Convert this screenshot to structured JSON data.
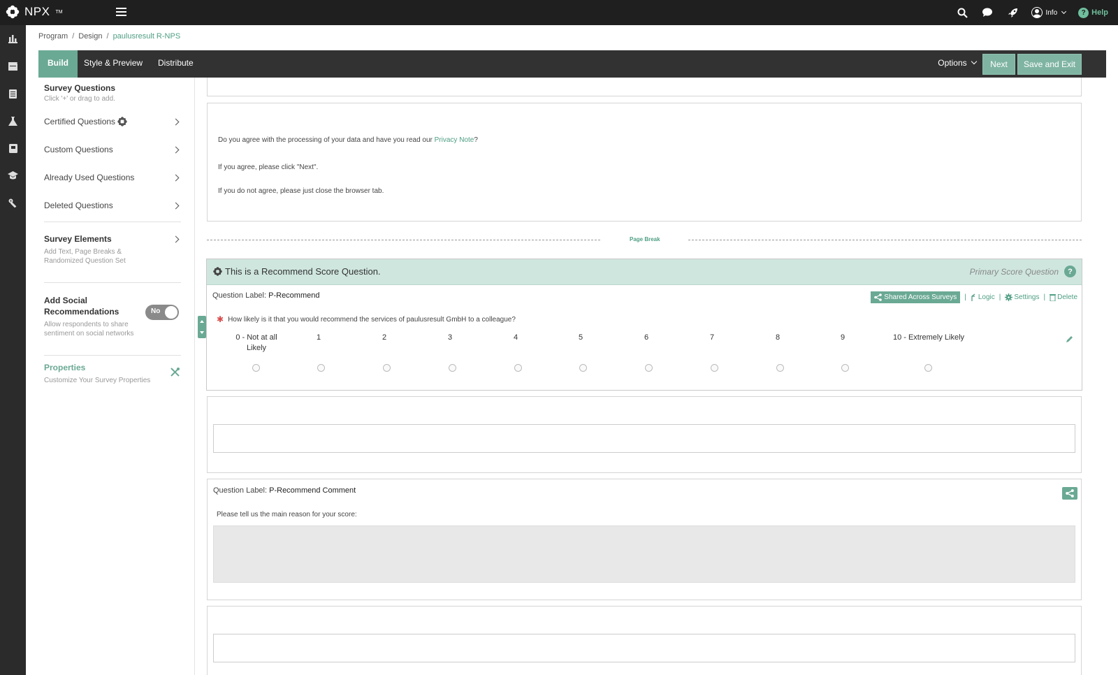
{
  "app": {
    "name": "NPX",
    "tm": "TM"
  },
  "topbar": {
    "icons": [
      "search-icon",
      "chat-icon",
      "rocket-icon"
    ],
    "user_label": "Info",
    "help_label": "Help"
  },
  "rail": [
    "chart-icon",
    "film-icon",
    "book-icon",
    "flask-icon",
    "notebook-icon",
    "graduation-icon",
    "wrench-icon"
  ],
  "breadcrumb": {
    "items": [
      "Program",
      "Design"
    ],
    "current": "paulusresult R-NPS",
    "separator": "/"
  },
  "tabs": {
    "build": "Build",
    "style": "Style & Preview",
    "distribute": "Distribute"
  },
  "actions": {
    "options": "Options",
    "next": "Next",
    "save_exit": "Save and Exit"
  },
  "panel": {
    "survey_questions": {
      "title": "Survey Questions",
      "sub": "Click '+' or drag to add."
    },
    "rows": [
      "Certified Questions",
      "Custom Questions",
      "Already Used Questions",
      "Deleted Questions"
    ],
    "survey_elements": {
      "title": "Survey Elements",
      "sub1": "Add Text, Page Breaks &",
      "sub2": "Randomized Question Set"
    },
    "social": {
      "title1": "Add Social",
      "title2": "Recommendations",
      "toggle": "No",
      "sub1": "Allow respondents to share",
      "sub2": "sentiment on social networks"
    },
    "properties": {
      "title": "Properties",
      "sub": "Customize Your Survey Properties"
    }
  },
  "consent": {
    "line1_pre": "Do you agree with the processing of your data and have you read our ",
    "line1_link": "Privacy Note",
    "line1_post": "?",
    "line2": "If you agree, please click \"Next\".",
    "line3": "If you do not agree, please just close the browser tab."
  },
  "page_break": "Page Break",
  "nps": {
    "header": "This is a Recommend Score Question.",
    "header_right": "Primary Score Question",
    "label_prefix": "Question Label:",
    "label": "P-Recommend",
    "shared": "Shared Across Surveys",
    "logic": "Logic",
    "settings": "Settings",
    "delete": "Delete",
    "question": "How likely is it that you would recommend the services of paulusresult GmbH to a colleague?",
    "scale": [
      "0 - Not at all Likely",
      "1",
      "2",
      "3",
      "4",
      "5",
      "6",
      "7",
      "8",
      "9",
      "10 - Extremely Likely"
    ]
  },
  "comment": {
    "label_prefix": "Question Label:",
    "label": "P-Recommend Comment",
    "question": "Please tell us the main reason for your score:"
  },
  "colors": {
    "accent": "#6aa994",
    "header_bg": "#1f1f1f",
    "tabbar_bg": "#323232",
    "nps_header_bg": "#cfe6df",
    "required": "#d94c4c"
  }
}
